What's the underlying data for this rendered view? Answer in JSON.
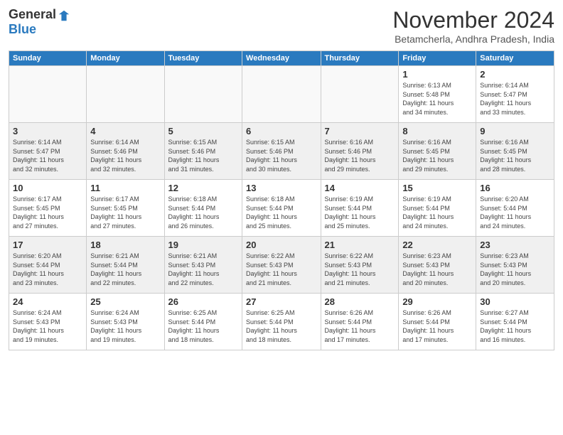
{
  "header": {
    "logo_general": "General",
    "logo_blue": "Blue",
    "month": "November 2024",
    "location": "Betamcherla, Andhra Pradesh, India"
  },
  "weekdays": [
    "Sunday",
    "Monday",
    "Tuesday",
    "Wednesday",
    "Thursday",
    "Friday",
    "Saturday"
  ],
  "weeks": [
    [
      {
        "day": "",
        "info": ""
      },
      {
        "day": "",
        "info": ""
      },
      {
        "day": "",
        "info": ""
      },
      {
        "day": "",
        "info": ""
      },
      {
        "day": "",
        "info": ""
      },
      {
        "day": "1",
        "info": "Sunrise: 6:13 AM\nSunset: 5:48 PM\nDaylight: 11 hours\nand 34 minutes."
      },
      {
        "day": "2",
        "info": "Sunrise: 6:14 AM\nSunset: 5:47 PM\nDaylight: 11 hours\nand 33 minutes."
      }
    ],
    [
      {
        "day": "3",
        "info": "Sunrise: 6:14 AM\nSunset: 5:47 PM\nDaylight: 11 hours\nand 32 minutes."
      },
      {
        "day": "4",
        "info": "Sunrise: 6:14 AM\nSunset: 5:46 PM\nDaylight: 11 hours\nand 32 minutes."
      },
      {
        "day": "5",
        "info": "Sunrise: 6:15 AM\nSunset: 5:46 PM\nDaylight: 11 hours\nand 31 minutes."
      },
      {
        "day": "6",
        "info": "Sunrise: 6:15 AM\nSunset: 5:46 PM\nDaylight: 11 hours\nand 30 minutes."
      },
      {
        "day": "7",
        "info": "Sunrise: 6:16 AM\nSunset: 5:46 PM\nDaylight: 11 hours\nand 29 minutes."
      },
      {
        "day": "8",
        "info": "Sunrise: 6:16 AM\nSunset: 5:45 PM\nDaylight: 11 hours\nand 29 minutes."
      },
      {
        "day": "9",
        "info": "Sunrise: 6:16 AM\nSunset: 5:45 PM\nDaylight: 11 hours\nand 28 minutes."
      }
    ],
    [
      {
        "day": "10",
        "info": "Sunrise: 6:17 AM\nSunset: 5:45 PM\nDaylight: 11 hours\nand 27 minutes."
      },
      {
        "day": "11",
        "info": "Sunrise: 6:17 AM\nSunset: 5:45 PM\nDaylight: 11 hours\nand 27 minutes."
      },
      {
        "day": "12",
        "info": "Sunrise: 6:18 AM\nSunset: 5:44 PM\nDaylight: 11 hours\nand 26 minutes."
      },
      {
        "day": "13",
        "info": "Sunrise: 6:18 AM\nSunset: 5:44 PM\nDaylight: 11 hours\nand 25 minutes."
      },
      {
        "day": "14",
        "info": "Sunrise: 6:19 AM\nSunset: 5:44 PM\nDaylight: 11 hours\nand 25 minutes."
      },
      {
        "day": "15",
        "info": "Sunrise: 6:19 AM\nSunset: 5:44 PM\nDaylight: 11 hours\nand 24 minutes."
      },
      {
        "day": "16",
        "info": "Sunrise: 6:20 AM\nSunset: 5:44 PM\nDaylight: 11 hours\nand 24 minutes."
      }
    ],
    [
      {
        "day": "17",
        "info": "Sunrise: 6:20 AM\nSunset: 5:44 PM\nDaylight: 11 hours\nand 23 minutes."
      },
      {
        "day": "18",
        "info": "Sunrise: 6:21 AM\nSunset: 5:44 PM\nDaylight: 11 hours\nand 22 minutes."
      },
      {
        "day": "19",
        "info": "Sunrise: 6:21 AM\nSunset: 5:43 PM\nDaylight: 11 hours\nand 22 minutes."
      },
      {
        "day": "20",
        "info": "Sunrise: 6:22 AM\nSunset: 5:43 PM\nDaylight: 11 hours\nand 21 minutes."
      },
      {
        "day": "21",
        "info": "Sunrise: 6:22 AM\nSunset: 5:43 PM\nDaylight: 11 hours\nand 21 minutes."
      },
      {
        "day": "22",
        "info": "Sunrise: 6:23 AM\nSunset: 5:43 PM\nDaylight: 11 hours\nand 20 minutes."
      },
      {
        "day": "23",
        "info": "Sunrise: 6:23 AM\nSunset: 5:43 PM\nDaylight: 11 hours\nand 20 minutes."
      }
    ],
    [
      {
        "day": "24",
        "info": "Sunrise: 6:24 AM\nSunset: 5:43 PM\nDaylight: 11 hours\nand 19 minutes."
      },
      {
        "day": "25",
        "info": "Sunrise: 6:24 AM\nSunset: 5:43 PM\nDaylight: 11 hours\nand 19 minutes."
      },
      {
        "day": "26",
        "info": "Sunrise: 6:25 AM\nSunset: 5:44 PM\nDaylight: 11 hours\nand 18 minutes."
      },
      {
        "day": "27",
        "info": "Sunrise: 6:25 AM\nSunset: 5:44 PM\nDaylight: 11 hours\nand 18 minutes."
      },
      {
        "day": "28",
        "info": "Sunrise: 6:26 AM\nSunset: 5:44 PM\nDaylight: 11 hours\nand 17 minutes."
      },
      {
        "day": "29",
        "info": "Sunrise: 6:26 AM\nSunset: 5:44 PM\nDaylight: 11 hours\nand 17 minutes."
      },
      {
        "day": "30",
        "info": "Sunrise: 6:27 AM\nSunset: 5:44 PM\nDaylight: 11 hours\nand 16 minutes."
      }
    ]
  ]
}
